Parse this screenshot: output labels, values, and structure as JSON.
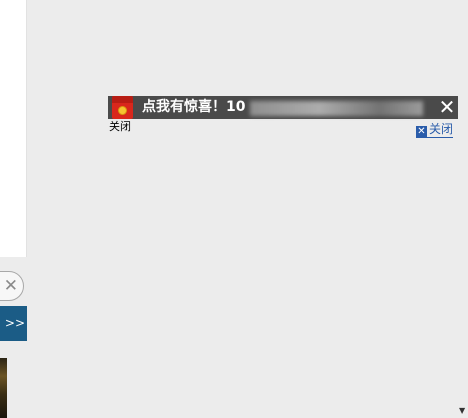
{
  "left_panel": {
    "close_icon_glyph": "✕",
    "more_button_label": ">>"
  },
  "banner": {
    "text": "点我有惊喜！10",
    "close_glyph": "✕",
    "envelope_icon": "red-envelope-icon",
    "background": "#4a4a4a"
  },
  "small_close_label": "关闭",
  "link_close": {
    "icon_glyph": "✕",
    "label": "关闭",
    "color": "#2a5caa"
  },
  "colors": {
    "page_background": "#ececec",
    "more_button": "#1b5c86",
    "envelope_red": "#d9271c"
  }
}
